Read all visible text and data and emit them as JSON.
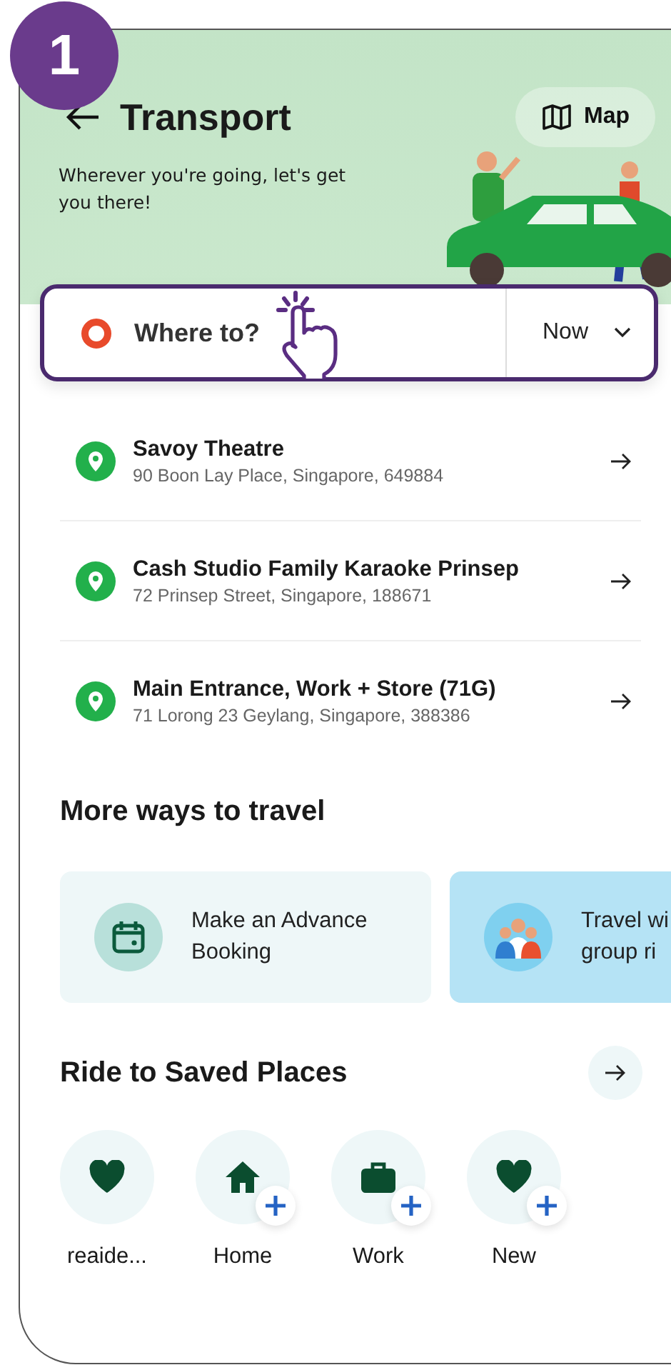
{
  "step_badge": "1",
  "header": {
    "title": "Transport",
    "subtitle": "Wherever you're going, let's get you there!",
    "map_button": "Map"
  },
  "search": {
    "placeholder": "Where to?",
    "time": "Now"
  },
  "recent_places": [
    {
      "name": "Savoy Theatre",
      "address": "90 Boon Lay Place, Singapore, 649884"
    },
    {
      "name": "Cash Studio Family Karaoke Prinsep",
      "address": "72 Prinsep Street, Singapore, 188671"
    },
    {
      "name": "Main Entrance, Work + Store (71G)",
      "address": "71 Lorong 23 Geylang, Singapore, 388386"
    }
  ],
  "more_ways": {
    "title": "More ways to travel",
    "cards": [
      {
        "kind": "booking",
        "lines": [
          "Make an Advance",
          "Booking"
        ]
      },
      {
        "kind": "group",
        "lines": [
          "Travel wi",
          "group ri"
        ]
      }
    ]
  },
  "saved_places": {
    "title": "Ride to Saved Places",
    "items": [
      {
        "kind": "heart",
        "label": "reaide...",
        "add": false
      },
      {
        "kind": "home",
        "label": "Home",
        "add": true
      },
      {
        "kind": "work",
        "label": "Work",
        "add": true
      },
      {
        "kind": "heart",
        "label": "New",
        "add": true
      }
    ]
  }
}
